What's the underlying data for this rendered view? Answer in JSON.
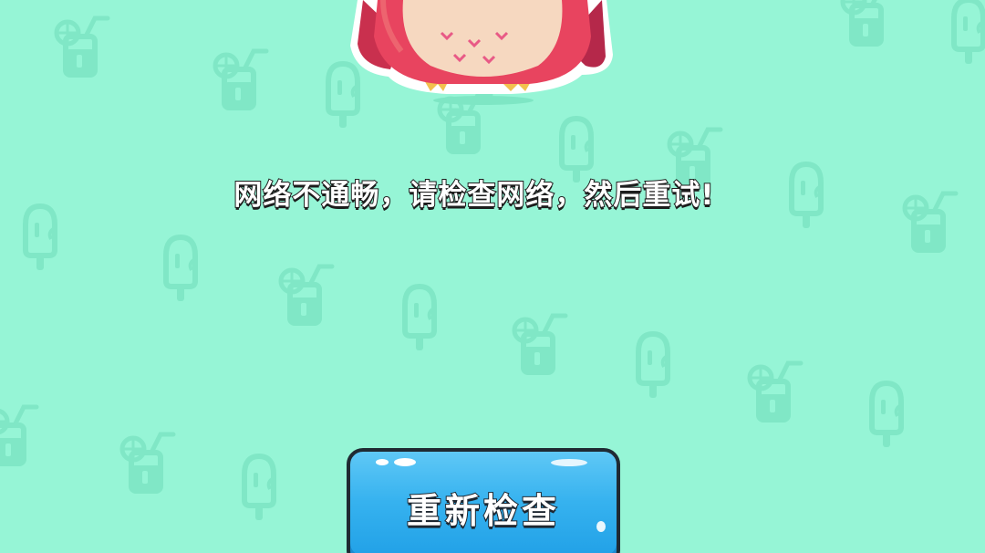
{
  "background": {
    "color": "#96f5d6",
    "pattern_color": "#7ee6c4",
    "pattern_icons": [
      "lemonade-glass-icon",
      "popsicle-icon"
    ]
  },
  "mascot": {
    "name": "owl-icon",
    "body_color": "#e8445f",
    "belly_color": "#f6d8c0"
  },
  "message": {
    "text": "网络不通畅，请检查网络，然后重试!"
  },
  "retry_button": {
    "label": "重新检查",
    "color": "#36b2ef"
  }
}
